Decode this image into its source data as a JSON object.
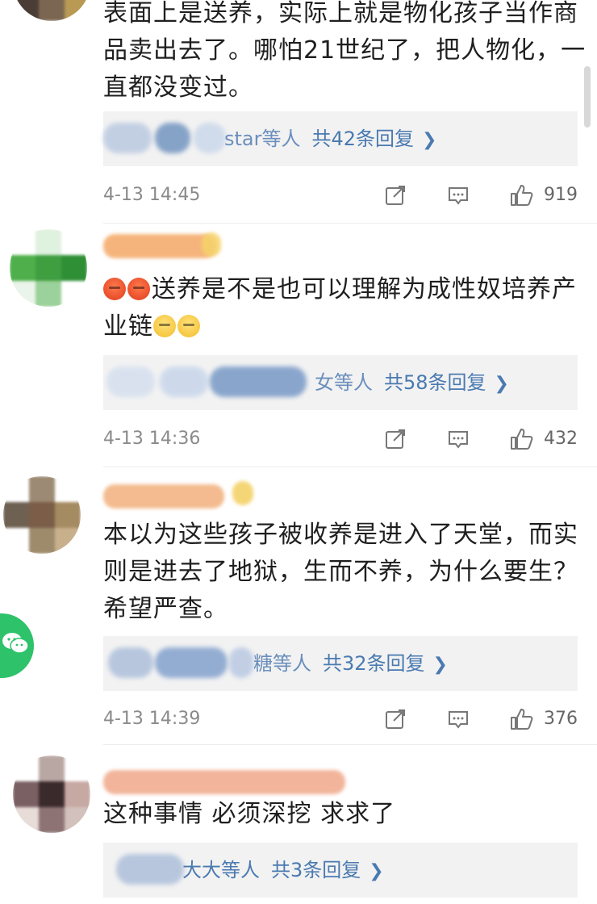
{
  "comments": [
    {
      "text": "表面上是送养，实际上就是物化孩子当作商品卖出去了。哪怕21世纪了，把人物化，一直都没变过。",
      "reply_users": "star等人",
      "reply_count": "共42条回复",
      "time": "4-13 14:45",
      "likes": "919"
    },
    {
      "text": "送养是不是也可以理解为成性奴培养产业链",
      "reply_users": "女等人",
      "reply_count": "共58条回复",
      "time": "4-13 14:36",
      "likes": "432"
    },
    {
      "text": "本以为这些孩子被收养是进入了天堂，而实则是进去了地狱，生而不养，为什么要生？希望严查。",
      "reply_users": "糖等人",
      "reply_count": "共32条回复",
      "time": "4-13 14:39",
      "likes": "376"
    },
    {
      "text": "这种事情 必须深挖 求求了",
      "reply_users": "大大等人",
      "reply_count": "共3条回复",
      "time": "",
      "likes": ""
    }
  ],
  "icons": {
    "share": "share-icon",
    "comment": "comment-icon",
    "like": "like-icon",
    "chevron": "chevron-right-icon",
    "wechat": "wechat-icon"
  },
  "colors": {
    "reply_link": "#4a7ab0",
    "reply_bg": "#f2f2f2",
    "wechat": "#2ec26a"
  }
}
